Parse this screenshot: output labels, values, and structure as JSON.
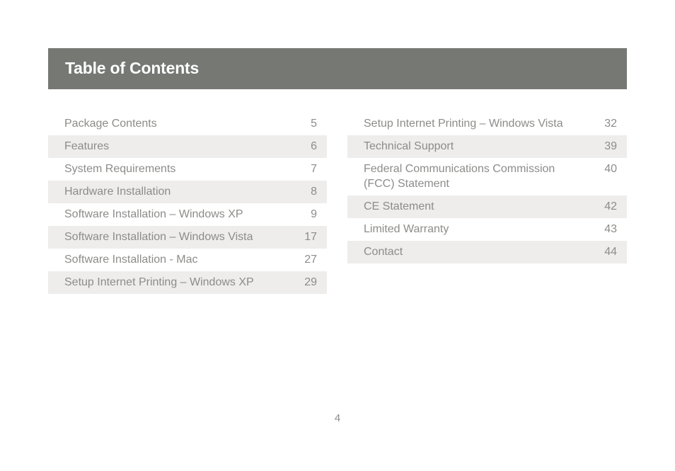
{
  "header": {
    "title": "Table of Contents",
    "background": "#767874"
  },
  "toc": {
    "left": [
      {
        "title": "Package Contents",
        "page": "5"
      },
      {
        "title": "Features",
        "page": "6"
      },
      {
        "title": "System Requirements",
        "page": "7"
      },
      {
        "title": "Hardware Installation",
        "page": "8"
      },
      {
        "title": "Software Installation – Windows XP",
        "page": "9"
      },
      {
        "title": "Software Installation – Windows Vista",
        "page": "17"
      },
      {
        "title": "Software Installation - Mac",
        "page": "27"
      },
      {
        "title": "Setup Internet Printing – Windows XP",
        "page": "29"
      }
    ],
    "right": [
      {
        "title": "Setup Internet Printing – Windows Vista",
        "page": "32"
      },
      {
        "title": "Technical Support",
        "page": "39"
      },
      {
        "title": "Federal Communications Commission (FCC) Statement",
        "page": "40"
      },
      {
        "title": "CE Statement",
        "page": "42"
      },
      {
        "title": "Limited Warranty",
        "page": "43"
      },
      {
        "title": "Contact",
        "page": "44"
      }
    ]
  },
  "footer": {
    "page_number": "4"
  }
}
